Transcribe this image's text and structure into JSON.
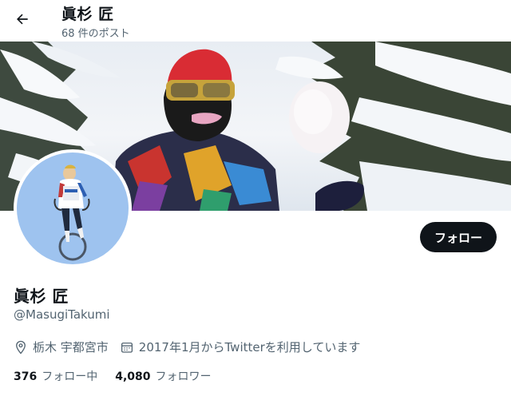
{
  "header": {
    "title": "眞杉 匠",
    "post_count": "68 件のポスト",
    "back_icon": "arrow-left-icon"
  },
  "profile": {
    "display_name": "眞杉 匠",
    "handle": "@MasugiTakumi",
    "follow_label": "フォロー",
    "location": "栃木 宇都宮市",
    "joined": "2017年1月からTwitterを利用しています",
    "location_icon": "map-pin-icon",
    "calendar_icon": "calendar-icon"
  },
  "stats": {
    "following_count": "376",
    "following_label": "フォロー中",
    "followers_count": "4,080",
    "followers_label": "フォロワー"
  },
  "colors": {
    "text": "#0f1419",
    "secondary": "#536471",
    "button_bg": "#0f1419",
    "button_text": "#ffffff"
  }
}
